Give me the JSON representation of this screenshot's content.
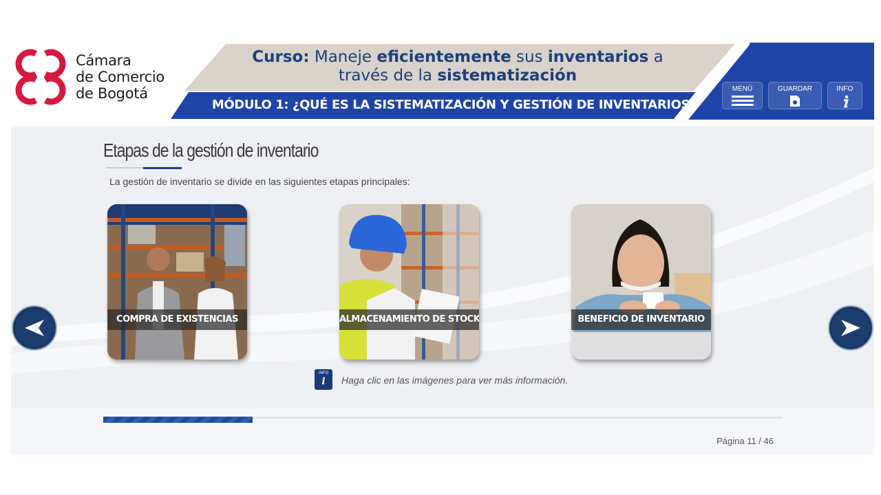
{
  "header": {
    "logo_lines": [
      "Cámara",
      "de Comercio",
      "de Bogotá"
    ],
    "course_prefix": "Curso:",
    "course_parts": [
      {
        "text": " Maneje ",
        "bold": false
      },
      {
        "text": "eficientemente",
        "bold": true
      },
      {
        "text": " sus ",
        "bold": false
      },
      {
        "text": "inventarios",
        "bold": true
      },
      {
        "text": " a través de la ",
        "bold": false
      },
      {
        "text": "sistematización",
        "bold": true
      }
    ],
    "module_title": "MÓDULO 1: ¿QUÉ ES LA SISTEMATIZACIÓN Y GESTIÓN DE INVENTARIOS?",
    "buttons": {
      "menu": "MENÚ",
      "save": "GUARDAR",
      "info": "INFO"
    }
  },
  "content": {
    "title": "Etapas de la gestión de inventario",
    "intro": "La gestión de inventario se divide en las siguientes etapas principales:",
    "cards": [
      {
        "label": "COMPRA DE EXISTENCIAS"
      },
      {
        "label": "ALMACENAMIENTO DE STOCK"
      },
      {
        "label": "BENEFICIO DE INVENTARIO"
      }
    ],
    "hint_icon": "INFO",
    "hint": "Haga clic en las imágenes para ver más información."
  },
  "footer": {
    "progress": 0.22,
    "page_label": "Página 11 / 46"
  },
  "colors": {
    "brand_red": "#d7193f",
    "brand_blue": "#1f44a8",
    "dark_navy": "#1a3a78",
    "banner_beige": "#d9d3cc"
  },
  "icons": {
    "prev": "arrow-left-icon",
    "next": "arrow-right-icon",
    "menu": "hamburger-icon",
    "save": "save-document-icon",
    "info": "info-icon"
  }
}
